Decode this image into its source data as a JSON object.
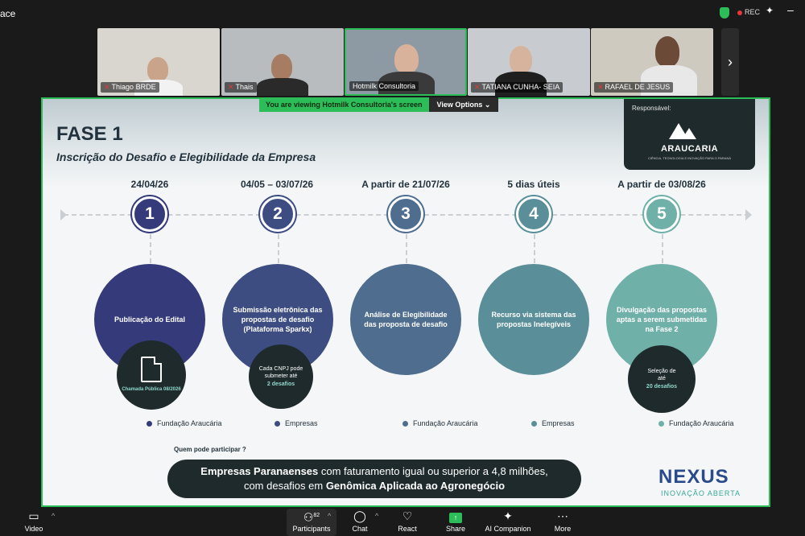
{
  "topbar": {
    "app_name": "ace",
    "rec_label": "REC"
  },
  "participants_strip": [
    {
      "name": "Thiago BRDE",
      "muted": true
    },
    {
      "name": "Thais",
      "muted": true
    },
    {
      "name": "Hotmilk Consultoria",
      "muted": false,
      "active": true
    },
    {
      "name": "TATIANA CUNHA- SEIA",
      "muted": true
    },
    {
      "name": "RAFAEL DE JESUS",
      "muted": true
    }
  ],
  "share_banner": {
    "viewing_text": "You are viewing  Hotmilk Consultoria's screen",
    "view_options": "View Options"
  },
  "slide": {
    "title": "FASE 1",
    "subtitle": "Inscrição do Desafio e Elegibilidade da Empresa",
    "responsavel_label": "Responsável:",
    "responsavel_logo": "ARAUCARIA",
    "responsavel_logo_sub": "CIÊNCIA, TECNOLOGIA E INOVAÇÃO PARA O PARANÁ",
    "phases": [
      {
        "number": "1",
        "date": "24/04/26",
        "text": "Publicação do Edital",
        "small_icon": "document-icon",
        "small_text": "",
        "small_highlight": "Chamada Pública 08/2026",
        "responsible": "Fundação Araucária",
        "color": "#353b7a"
      },
      {
        "number": "2",
        "date": "04/05 – 03/07/26",
        "text": "Submissão eletrônica das propostas de desafio (Plataforma Sparkx)",
        "small_text": "Cada CNPJ pode submeter até",
        "small_highlight": "2 desafios",
        "responsible": "Empresas",
        "color": "#3d4d82"
      },
      {
        "number": "3",
        "date": "A partir de 21/07/26",
        "text": "Análise de Elegibilidade das proposta de desafio",
        "responsible": "Fundação Araucária",
        "color": "#4f6d8f"
      },
      {
        "number": "4",
        "date": "5 dias úteis",
        "text": "Recurso via sistema das propostas Inelegíveis",
        "responsible": "Empresas",
        "color": "#5a8f9a"
      },
      {
        "number": "5",
        "date": "A partir de 03/08/26",
        "text": "Divulgação das propostas aptas a serem submetidas na Fase 2",
        "small_text": "Seleção de até",
        "small_highlight": "20 desafios",
        "responsible": "Fundação Araucária",
        "color": "#6fb0a8"
      }
    ],
    "who_label": "Quem pode participar ?",
    "pill_line1_bold": "Empresas Paranaenses",
    "pill_line1_rest": " com faturamento igual ou superior a 4,8 milhões,",
    "pill_line2_pre": "com desafios em ",
    "pill_line2_bold": "Genômica Aplicada ao Agronegócio",
    "brand_name": "NEXUS",
    "brand_sub": "INOVAÇÃO ABERTA"
  },
  "toolbar": {
    "video": "Video",
    "participants": "Participants",
    "participants_count": "82",
    "chat": "Chat",
    "react": "React",
    "share": "Share",
    "ai_companion": "AI Companion",
    "more": "More"
  }
}
